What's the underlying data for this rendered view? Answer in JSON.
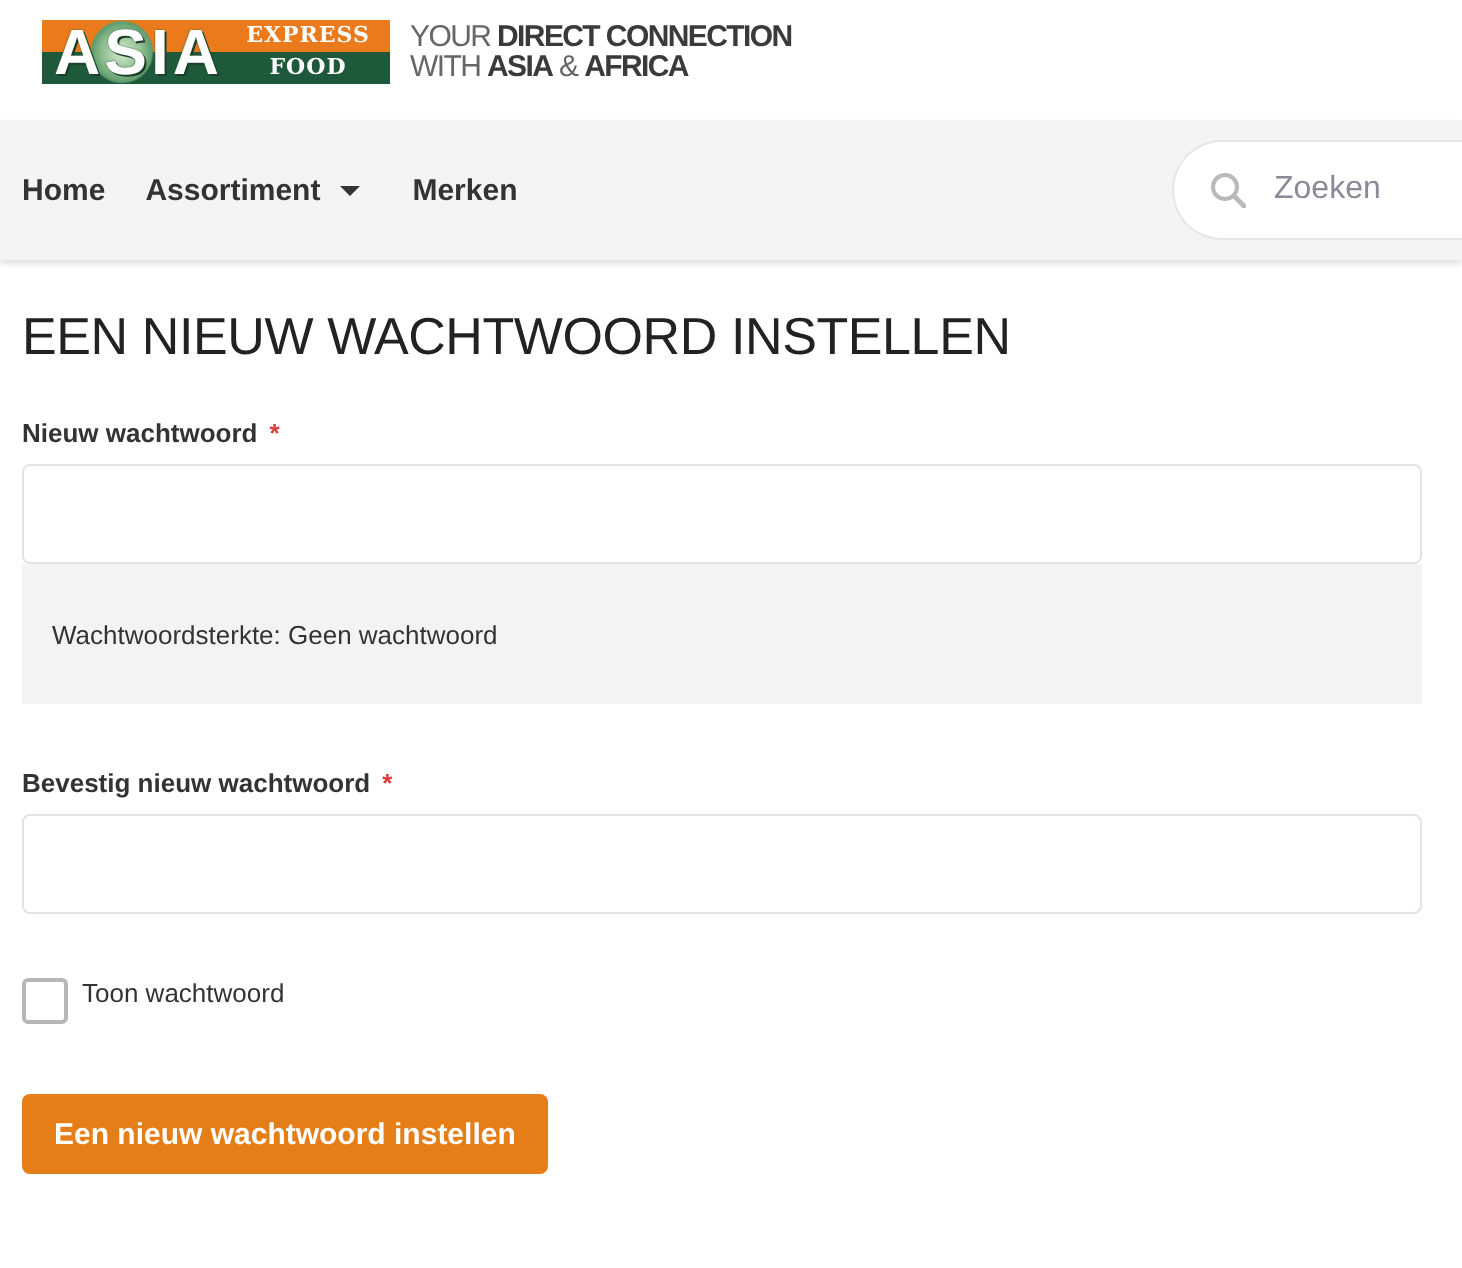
{
  "header": {
    "logo": {
      "word": "ASIA",
      "line_1": "EXPRESS",
      "line_2": "FOOD"
    },
    "tagline": [
      "YOUR **DIRECT CONNECTION**",
      "WITH **ASIA** & **AFRICA**"
    ]
  },
  "nav": {
    "items": [
      {
        "label": "Home",
        "has_dropdown": false
      },
      {
        "label": "Assortiment",
        "has_dropdown": true
      },
      {
        "label": "Merken",
        "has_dropdown": false
      }
    ],
    "search": {
      "placeholder": "Zoeken"
    }
  },
  "page": {
    "title": "EEN NIEUW WACHTWOORD INSTELLEN",
    "fields": [
      {
        "label": "Nieuw wachtwoord",
        "required_mark": "*",
        "strength": "Wachtwoordsterkte: Geen wachtwoord"
      },
      {
        "label": "Bevestig nieuw wachtwoord",
        "required_mark": "*"
      }
    ],
    "show_password": {
      "label": "Toon wachtwoord",
      "checked": false
    },
    "submit": "Een nieuw wachtwoord instellen"
  }
}
